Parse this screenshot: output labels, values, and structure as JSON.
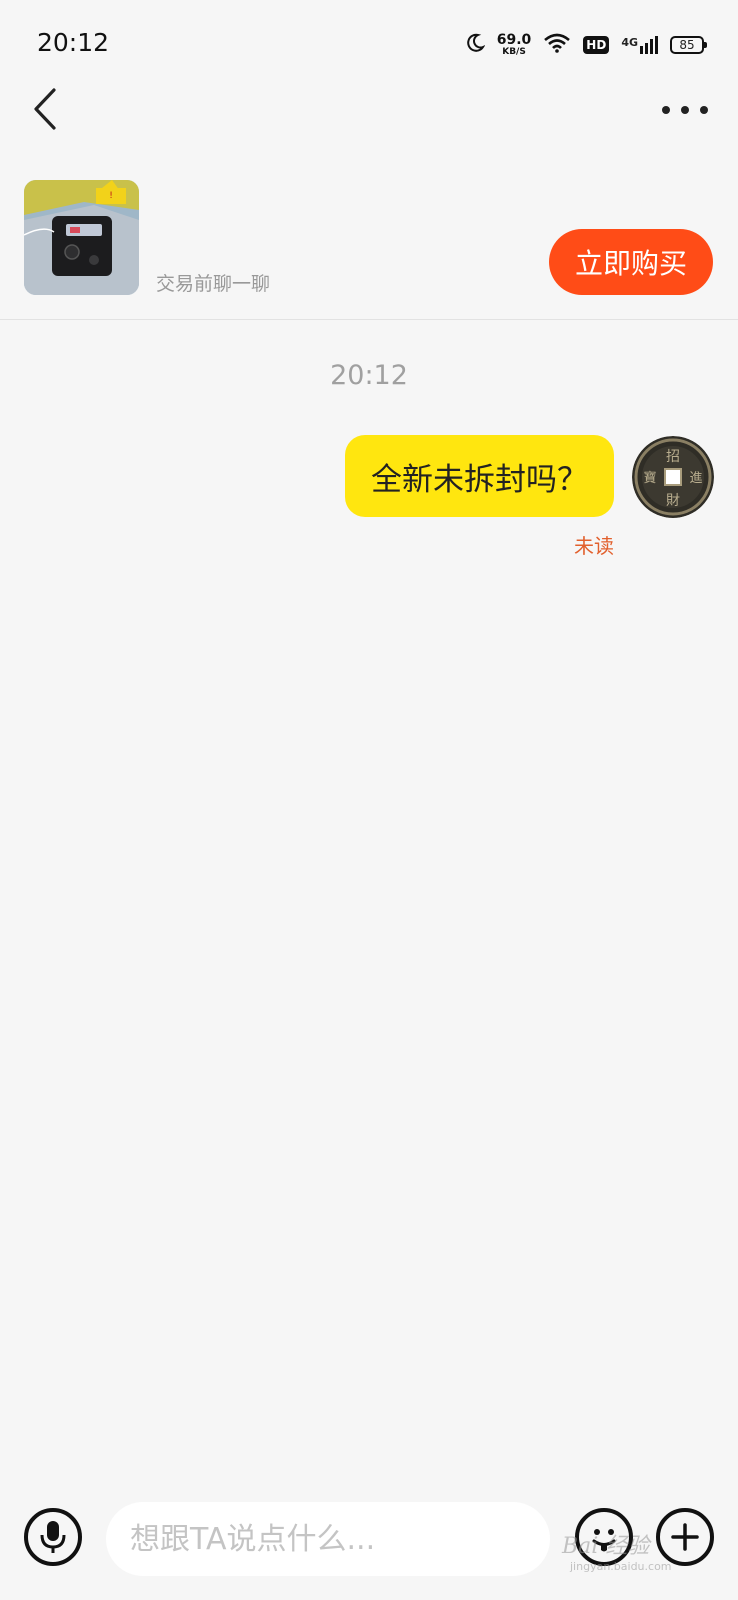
{
  "status_bar": {
    "time": "20:12",
    "net_speed_value": "69.0",
    "net_speed_unit": "KB/S",
    "hd_label": "HD",
    "signal_label": "4G",
    "battery": "85"
  },
  "nav": {
    "back_icon": "chevron-left-icon",
    "more_icon": "more-horizontal-icon"
  },
  "product": {
    "hint": "交易前聊一聊",
    "buy_label": "立即购买",
    "buy_color": "#ff4c17"
  },
  "chat": {
    "timestamp": "20:12",
    "messages": [
      {
        "text": "全新未拆封吗？",
        "status": "未读",
        "bubble_color": "#ffe60f"
      }
    ]
  },
  "input_bar": {
    "placeholder": "想跟TA说点什么...",
    "value": ""
  },
  "watermark": {
    "text": "Bai 经验",
    "sub": "jingyan.baidu.com"
  }
}
